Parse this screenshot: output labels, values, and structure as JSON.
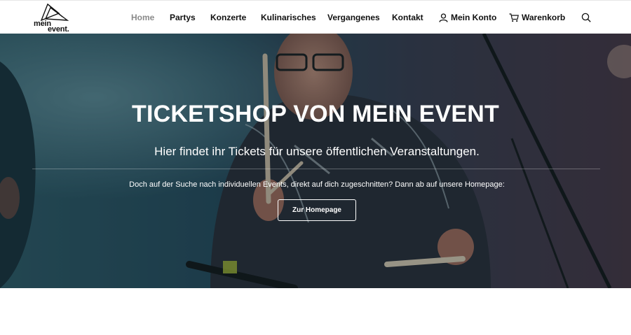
{
  "brand": {
    "line1": "mein",
    "line2": "event."
  },
  "nav": {
    "items": [
      {
        "label": "Home"
      },
      {
        "label": "Partys"
      },
      {
        "label": "Konzerte"
      },
      {
        "label": "Kulinarisches"
      },
      {
        "label": "Vergangenes"
      },
      {
        "label": "Kontakt"
      },
      {
        "label": "Mein Konto",
        "icon": "user-icon"
      },
      {
        "label": "Warenkorb",
        "icon": "cart-icon"
      }
    ],
    "search_icon": "search-icon",
    "active_color": "#8a8a8a"
  },
  "hero": {
    "title": "TICKETSHOP VON MEIN EVENT",
    "subtitle": "Hier findet ihr Tickets für unsere öffentlichen Veranstaltungen.",
    "note": "Doch auf der Suche nach individuellen Events, direkt auf dich zugeschnitten? Dann ab auf unsere Homepage:",
    "button_label": "Zur Homepage",
    "background": "photo of a drummer with drumsticks on stage, teal tint"
  },
  "colors": {
    "hero_tint": "#1d3640",
    "text_on_hero": "#ffffff"
  }
}
